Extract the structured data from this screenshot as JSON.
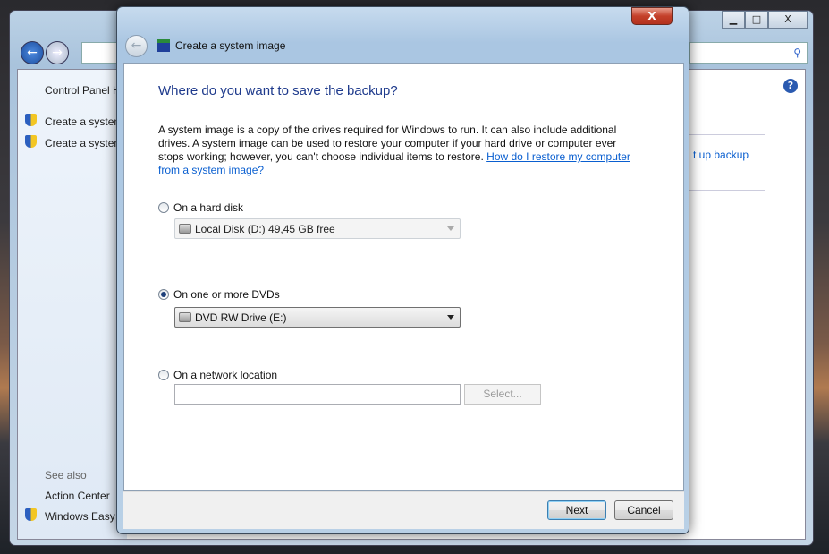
{
  "background_window": {
    "controls": {
      "minimize": "▁",
      "maximize": "□",
      "close": "X"
    },
    "search_icon": "magnifier",
    "help": "?",
    "left_pane": {
      "home": "Control Panel H",
      "items": [
        "Create a system",
        "Create a system"
      ],
      "see_also": "See also",
      "see_also_items": [
        "Action Center",
        "Windows Easy T"
      ]
    },
    "right_link": "t up backup"
  },
  "dialog": {
    "title": "Create a system image",
    "close": "X",
    "heading": "Where do you want to save the backup?",
    "description": "A system image is a copy of the drives required for Windows to run. It can also include additional drives. A system image can be used to restore your computer if your hard drive or computer ever stops working; however, you can't choose individual items to restore. ",
    "help_link": "How do I restore my computer from a system image?",
    "options": [
      {
        "label": "On a hard disk",
        "selected": false,
        "value": "Local Disk (D:)  49,45 GB free"
      },
      {
        "label": "On one or more DVDs",
        "selected": true,
        "value": "DVD RW Drive (E:)"
      },
      {
        "label": "On a network location",
        "selected": false,
        "value": "",
        "button": "Select..."
      }
    ],
    "next": "Next",
    "cancel": "Cancel"
  }
}
